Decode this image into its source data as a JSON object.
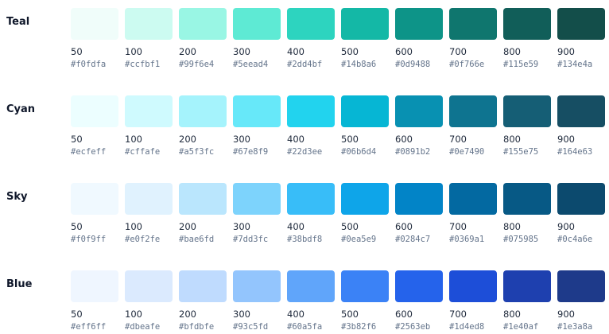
{
  "palettes": [
    {
      "name": "Teal",
      "swatches": [
        {
          "shade": "50",
          "hex": "#f0fdfa"
        },
        {
          "shade": "100",
          "hex": "#ccfbf1"
        },
        {
          "shade": "200",
          "hex": "#99f6e4"
        },
        {
          "shade": "300",
          "hex": "#5eead4"
        },
        {
          "shade": "400",
          "hex": "#2dd4bf"
        },
        {
          "shade": "500",
          "hex": "#14b8a6"
        },
        {
          "shade": "600",
          "hex": "#0d9488"
        },
        {
          "shade": "700",
          "hex": "#0f766e"
        },
        {
          "shade": "800",
          "hex": "#115e59"
        },
        {
          "shade": "900",
          "hex": "#134e4a"
        }
      ]
    },
    {
      "name": "Cyan",
      "swatches": [
        {
          "shade": "50",
          "hex": "#ecfeff"
        },
        {
          "shade": "100",
          "hex": "#cffafe"
        },
        {
          "shade": "200",
          "hex": "#a5f3fc"
        },
        {
          "shade": "300",
          "hex": "#67e8f9"
        },
        {
          "shade": "400",
          "hex": "#22d3ee"
        },
        {
          "shade": "500",
          "hex": "#06b6d4"
        },
        {
          "shade": "600",
          "hex": "#0891b2"
        },
        {
          "shade": "700",
          "hex": "#0e7490"
        },
        {
          "shade": "800",
          "hex": "#155e75"
        },
        {
          "shade": "900",
          "hex": "#164e63"
        }
      ]
    },
    {
      "name": "Sky",
      "swatches": [
        {
          "shade": "50",
          "hex": "#f0f9ff"
        },
        {
          "shade": "100",
          "hex": "#e0f2fe"
        },
        {
          "shade": "200",
          "hex": "#bae6fd"
        },
        {
          "shade": "300",
          "hex": "#7dd3fc"
        },
        {
          "shade": "400",
          "hex": "#38bdf8"
        },
        {
          "shade": "500",
          "hex": "#0ea5e9"
        },
        {
          "shade": "600",
          "hex": "#0284c7"
        },
        {
          "shade": "700",
          "hex": "#0369a1"
        },
        {
          "shade": "800",
          "hex": "#075985"
        },
        {
          "shade": "900",
          "hex": "#0c4a6e"
        }
      ]
    },
    {
      "name": "Blue",
      "swatches": [
        {
          "shade": "50",
          "hex": "#eff6ff"
        },
        {
          "shade": "100",
          "hex": "#dbeafe"
        },
        {
          "shade": "200",
          "hex": "#bfdbfe"
        },
        {
          "shade": "300",
          "hex": "#93c5fd"
        },
        {
          "shade": "400",
          "hex": "#60a5fa"
        },
        {
          "shade": "500",
          "hex": "#3b82f6"
        },
        {
          "shade": "600",
          "hex": "#2563eb"
        },
        {
          "shade": "700",
          "hex": "#1d4ed8"
        },
        {
          "shade": "800",
          "hex": "#1e40af"
        },
        {
          "shade": "900",
          "hex": "#1e3a8a"
        }
      ]
    }
  ]
}
